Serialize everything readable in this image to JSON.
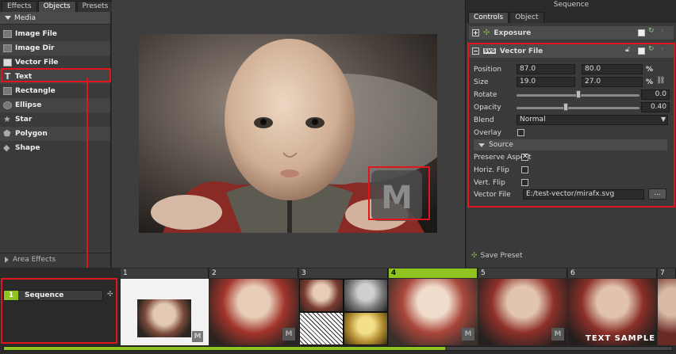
{
  "left_panel": {
    "tabs": [
      "Effects",
      "Objects",
      "Presets"
    ],
    "section": "Media",
    "items": [
      "Image File",
      "Image Dir",
      "Vector File",
      "Text",
      "Rectangle",
      "Ellipse",
      "Star",
      "Polygon",
      "Shape"
    ],
    "footer": "Area Effects"
  },
  "viewer": {
    "watermark_letter": "M"
  },
  "right_panel": {
    "title": "Sequence",
    "tabs": [
      "Controls",
      "Object"
    ],
    "exposure_label": "Exposure",
    "vector_label": "Vector File",
    "svg_badge": "SVG",
    "position": {
      "label": "Position",
      "x": "87.0",
      "y": "80.0",
      "unit": "%"
    },
    "size": {
      "label": "Size",
      "x": "19.0",
      "y": "27.0",
      "unit": "%"
    },
    "rotate": {
      "label": "Rotate",
      "value": "0.0",
      "level": 0.5
    },
    "opacity": {
      "label": "Opacity",
      "value": "0.40",
      "level": 0.4
    },
    "blend": {
      "label": "Blend",
      "value": "Normal"
    },
    "overlay_label": "Overlay",
    "source_label": "Source",
    "preserve_label": "Preserve Aspect",
    "hflip_label": "Horiz. Flip",
    "vflip_label": "Vert. Flip",
    "vfile_label": "Vector File",
    "vfile_value": "E:/test-vector/mirafx.svg",
    "browse_label": "...",
    "save_preset": "Save Preset"
  },
  "timeline": {
    "track_number": "1",
    "track_name": "Sequence",
    "frames": [
      "1",
      "2",
      "3",
      "4",
      "5",
      "6",
      "7"
    ],
    "text_sample": "TEXT SAMPLE",
    "progress": 0.66
  },
  "colors": {
    "highlight": "#e0161c",
    "accent_green": "#8fc31f"
  }
}
